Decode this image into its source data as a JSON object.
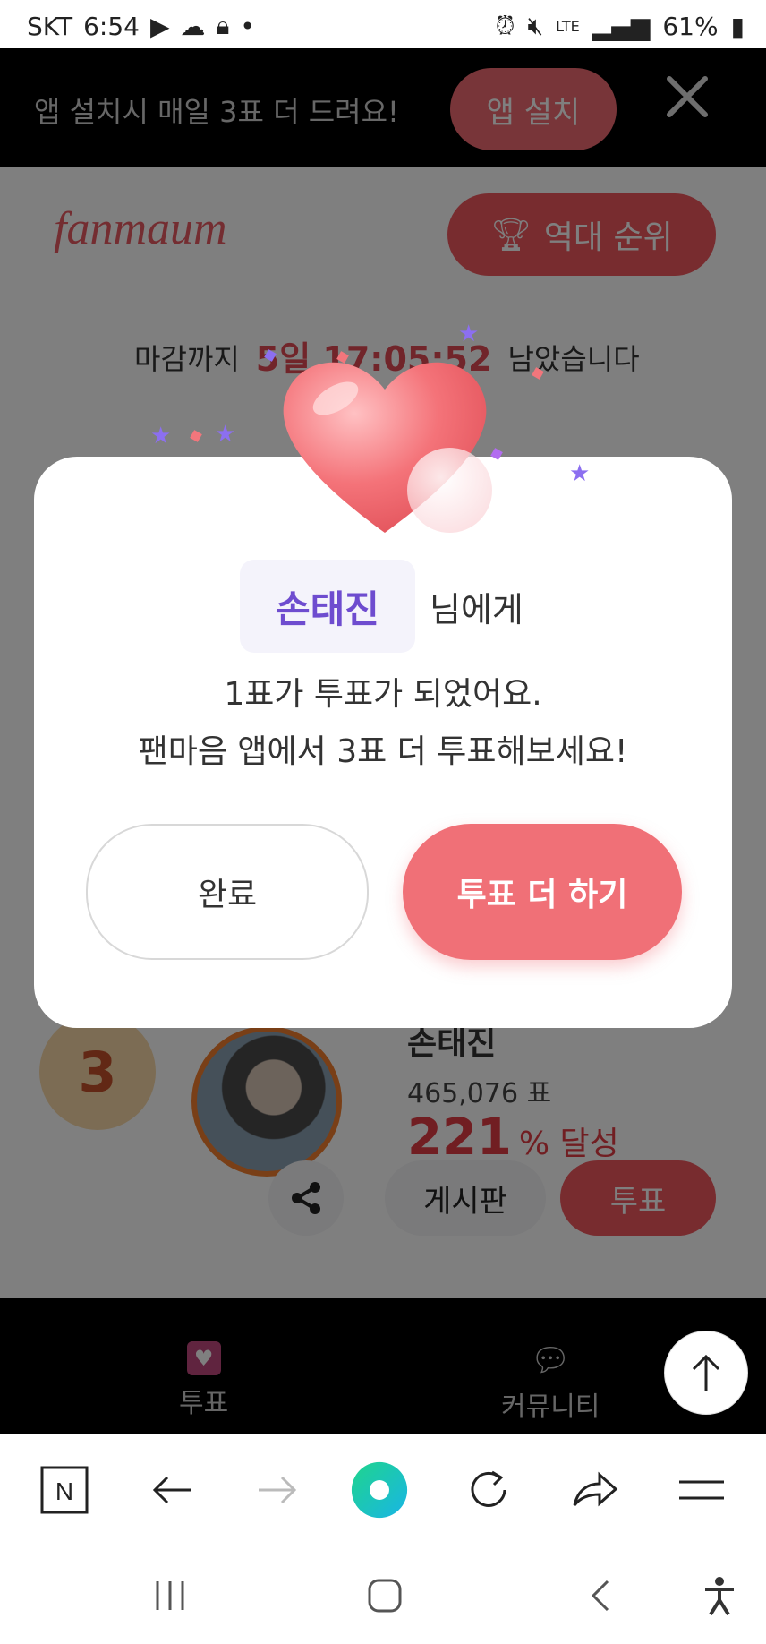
{
  "status_bar": {
    "carrier": "SKT",
    "time": "6:54",
    "battery": "61%",
    "network": "LTE"
  },
  "banner": {
    "text": "앱 설치시 매일 3표 더 드려요!",
    "install_button": "앱 설치"
  },
  "header": {
    "logo_text": "fanmaum",
    "ranking_button": "역대 순위"
  },
  "deadline": {
    "prefix": "마감까지",
    "time": "5일 17:05:52",
    "suffix": "남았습니다"
  },
  "entry": {
    "rank": "3",
    "name": "손태진",
    "votes": "465,076 표",
    "percent": "221",
    "percent_unit": "% 달성",
    "board_button": "게시판",
    "vote_button": "투표"
  },
  "tabs": {
    "vote_label": "투표",
    "community_label": "커뮤니티"
  },
  "dialog": {
    "recipient": "손태진",
    "recipient_suffix": "님에게",
    "line1": "1표가 투표가 되었어요.",
    "line2": "팬마음 앱에서 3표 더 투표해보세요!",
    "done_button": "완료",
    "more_button": "투표 더 하기"
  },
  "colors": {
    "accent": "#f07077",
    "recipient": "#6e4ccf",
    "overlay": "rgba(0,0,0,0.5)"
  },
  "icons": [
    "play-icon",
    "cloud-icon",
    "lock-icon",
    "alarm-icon",
    "mute-icon",
    "signal-icon",
    "battery-icon",
    "close-icon",
    "trophy-icon",
    "share-icon",
    "heart-tab-icon",
    "chat-icon",
    "arrow-up-icon",
    "naver-icon",
    "back-icon",
    "forward-icon",
    "home-circle-icon",
    "refresh-icon",
    "share-arrow-icon",
    "menu-icon",
    "recent-apps-icon",
    "home-icon",
    "back-nav-icon",
    "accessibility-icon"
  ]
}
